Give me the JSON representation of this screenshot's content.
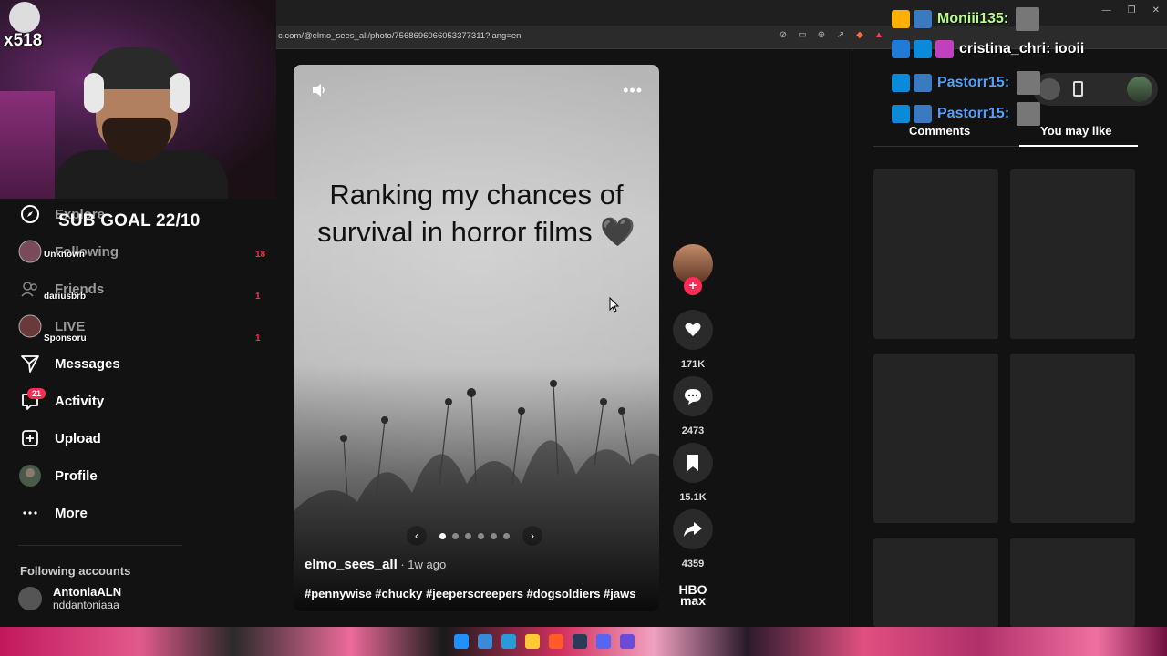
{
  "browser": {
    "url": "c.com/@elmo_sees_all/photo/7568696066053377311?lang=en"
  },
  "stream_overlay": {
    "counter": "x518",
    "sub_goal": "SUB GOAL 22/10",
    "overlay_names": [
      "Unknown",
      "dariusbrb",
      "Sponsoru"
    ],
    "overlay_counts": [
      "18",
      "1",
      "1"
    ],
    "chat": [
      {
        "name": "Moniii135:",
        "message": "",
        "color": "#ffd54a"
      },
      {
        "name": "cristina_chri:",
        "message": "iooii",
        "color": "#ffffff"
      },
      {
        "name": "Pastorr15:",
        "message": "",
        "color": "#4fa3ff"
      },
      {
        "name": "Pastorr15:",
        "message": "",
        "color": "#4fa3ff"
      }
    ]
  },
  "sidebar": {
    "items": [
      {
        "label": "Explore",
        "icon": "compass-icon"
      },
      {
        "label": "Following",
        "icon": "avatar-icon"
      },
      {
        "label": "Friends",
        "icon": "friends-icon"
      },
      {
        "label": "LIVE",
        "icon": "live-icon"
      },
      {
        "label": "Messages",
        "icon": "send-icon"
      },
      {
        "label": "Activity",
        "icon": "inbox-icon"
      },
      {
        "label": "Upload",
        "icon": "plus-square-icon"
      },
      {
        "label": "Profile",
        "icon": "profile-avatar"
      },
      {
        "label": "More",
        "icon": "more-dots-icon"
      }
    ],
    "activity_badge": "21",
    "following_accounts_title": "Following accounts",
    "accounts": [
      {
        "display_name": "AntoniaALN",
        "username": "nddantoniaaa"
      }
    ]
  },
  "post": {
    "caption_line1": "Ranking my chances of",
    "caption_line2": "survival in horror films 🖤",
    "author": "elmo_sees_all",
    "posted": " · 1w ago",
    "hashtags": "#pennywise #chucky #jeeperscreepers #dogsoldiers #jaws",
    "carousel_pages": 6,
    "carousel_active": 1
  },
  "actions": {
    "likes": "171K",
    "comments": "2473",
    "saves": "15.1K",
    "shares": "4359",
    "brand": "HBO max"
  },
  "right_panel": {
    "tabs": [
      "Comments",
      "You may like"
    ],
    "active_tab": "You may like"
  },
  "colors": {
    "accent": "#fe2c55",
    "background": "#121212"
  }
}
